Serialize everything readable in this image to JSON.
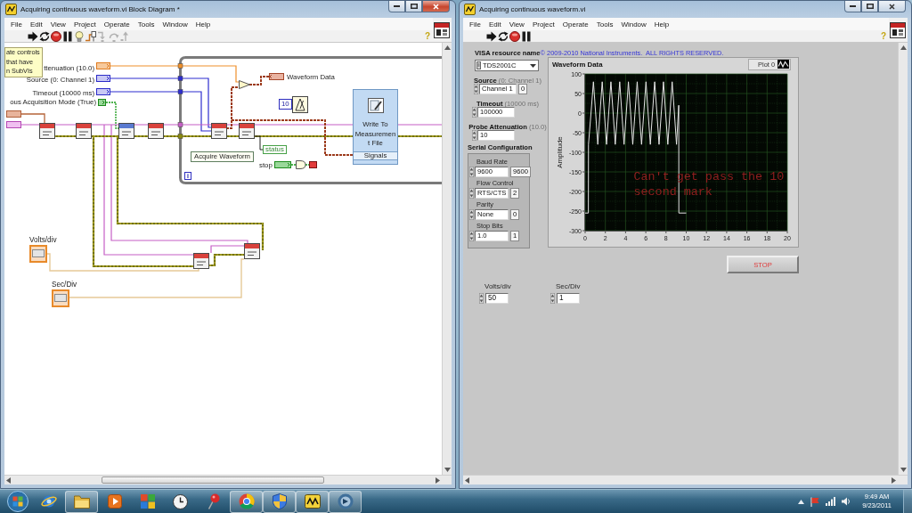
{
  "block_diagram": {
    "window": {
      "title": "Acquiring continuous waveform.vi Block Diagram *",
      "active": true
    },
    "menu": [
      "File",
      "Edit",
      "View",
      "Project",
      "Operate",
      "Tools",
      "Window",
      "Help"
    ],
    "toolbar": [
      {
        "kind": "run",
        "disabled": false
      },
      {
        "kind": "run_continuously",
        "disabled": false
      },
      {
        "kind": "abort",
        "disabled": false
      },
      {
        "kind": "pause",
        "disabled": false
      },
      {
        "kind": "highlight",
        "disabled": false
      },
      {
        "kind": "retain",
        "disabled": false
      },
      {
        "kind": "step_into",
        "disabled": true
      },
      {
        "kind": "step_over",
        "disabled": true
      },
      {
        "kind": "step_out",
        "disabled": true
      }
    ],
    "help_button": "?",
    "diagram": {
      "note": "ate controls\nthat have\nn SubVIs",
      "controls": [
        {
          "label": "ttenuation (10.0)",
          "kind": "float"
        },
        {
          "label": "Source (0: Channel 1)",
          "kind": "integer"
        },
        {
          "label": "Timeout (10000 ms)",
          "kind": "integer"
        },
        {
          "label": "ous Acquisition Mode (True)",
          "kind": "boolean"
        }
      ],
      "indicator_label": "Waveform Data",
      "constant": "10",
      "express_vi": {
        "title": "Write To Measurement File",
        "input": "Signals"
      },
      "free_label": "Acquire Waveform",
      "unbundle": "status",
      "stop_label": "stop",
      "iteration_terminal": "i",
      "outside_controls": [
        {
          "label": "Volts/div"
        },
        {
          "label": "Sec/Div"
        }
      ]
    }
  },
  "front_panel": {
    "window": {
      "title": "Acquiring continuous waveform.vi",
      "active": false
    },
    "menu": [
      "File",
      "Edit",
      "View",
      "Project",
      "Operate",
      "Tools",
      "Window",
      "Help"
    ],
    "toolbar": [
      {
        "kind": "run",
        "disabled": false
      },
      {
        "kind": "run_continuously",
        "disabled": false
      },
      {
        "kind": "abort",
        "disabled": false
      },
      {
        "kind": "pause",
        "disabled": false
      }
    ],
    "help_button": "?",
    "visa_resource": {
      "label": "VISA resource name",
      "value": "TDS2001C"
    },
    "copyright": "© 2009-2010 National Instruments.  ALL RIGHTS RESERVED.",
    "controls": [
      {
        "kind": "ring",
        "label": "**Source** (0: Channel 1)",
        "value": "Channel 1",
        "index": "0"
      },
      {
        "kind": "numeric",
        "label": "**Timeout** (10000 ms)",
        "value": "100000"
      },
      {
        "kind": "numeric",
        "label": "**Probe Attenuation** (10.0)",
        "value": "10"
      }
    ],
    "serial_configuration": {
      "title": "Serial Configuration",
      "fields": [
        {
          "label": "Baud Rate",
          "value": "9600",
          "index": "9600"
        },
        {
          "label": "Flow Control",
          "value": "RTS/CTS",
          "index": "2"
        },
        {
          "label": "Parity",
          "value": "None",
          "index": "0"
        },
        {
          "label": "Stop Bits",
          "value": "1.0",
          "index": "1"
        }
      ]
    },
    "graph": {
      "chart_data": {
        "type": "line",
        "title": "Waveform Data",
        "ylabel": "Amplitude",
        "x": [
          0,
          0.32,
          0.33,
          0.58,
          0.82,
          1.04,
          1.25,
          1.47,
          1.69,
          1.9,
          2.12,
          2.33,
          2.55,
          2.77,
          2.98,
          3.2,
          3.42,
          3.63,
          3.85,
          4.07,
          4.28,
          4.5,
          4.71,
          4.93,
          5.15,
          5.36,
          5.58,
          5.8,
          6.02,
          6.23,
          6.45,
          6.66,
          6.88,
          7.1,
          7.31,
          7.53,
          7.75,
          7.96,
          8.18,
          8.39,
          8.61,
          8.83,
          9.04,
          9.26,
          9.27,
          10
        ],
        "series": [
          {
            "name": "Plot 0",
            "color": "#e6e6e6",
            "values": [
              -255,
              -255,
              -80,
              0,
              80,
              0,
              -80,
              0,
              80,
              0,
              -80,
              0,
              80,
              0,
              -80,
              0,
              80,
              0,
              -80,
              0,
              80,
              0,
              -80,
              0,
              80,
              0,
              -80,
              0,
              80,
              0,
              -80,
              0,
              80,
              0,
              -80,
              0,
              80,
              0,
              -80,
              0,
              80,
              0,
              -80,
              20,
              -255,
              -255
            ]
          }
        ],
        "xlim": [
          0,
          20
        ],
        "ylim": [
          -300,
          100
        ],
        "xticks": [
          0,
          2,
          4,
          6,
          8,
          10,
          12,
          14,
          16,
          18,
          20
        ],
        "yticks": [
          -300,
          -250,
          -200,
          -150,
          -100,
          -50,
          0,
          50,
          100
        ],
        "grid": true,
        "annotations": [
          "Can't get pass the 10 second mark"
        ]
      }
    },
    "stop_button": "STOP",
    "bottom_controls": [
      {
        "label": "Volts/div",
        "value": "50"
      },
      {
        "label": "Sec/Div",
        "value": "1"
      }
    ]
  },
  "taskbar": {
    "items": [
      {
        "kind": "globe",
        "running": false
      },
      {
        "kind": "folder",
        "running": true
      },
      {
        "kind": "play",
        "running": false
      },
      {
        "kind": "tiles",
        "running": false
      },
      {
        "kind": "clock",
        "running": false
      },
      {
        "kind": "pin",
        "running": false
      },
      {
        "kind": "wheel",
        "running": true
      },
      {
        "kind": "shield",
        "running": true
      },
      {
        "kind": "waveform",
        "running": true
      },
      {
        "kind": "disc",
        "running": true
      }
    ],
    "time": "9:49 AM",
    "date": "9/23/2011"
  }
}
